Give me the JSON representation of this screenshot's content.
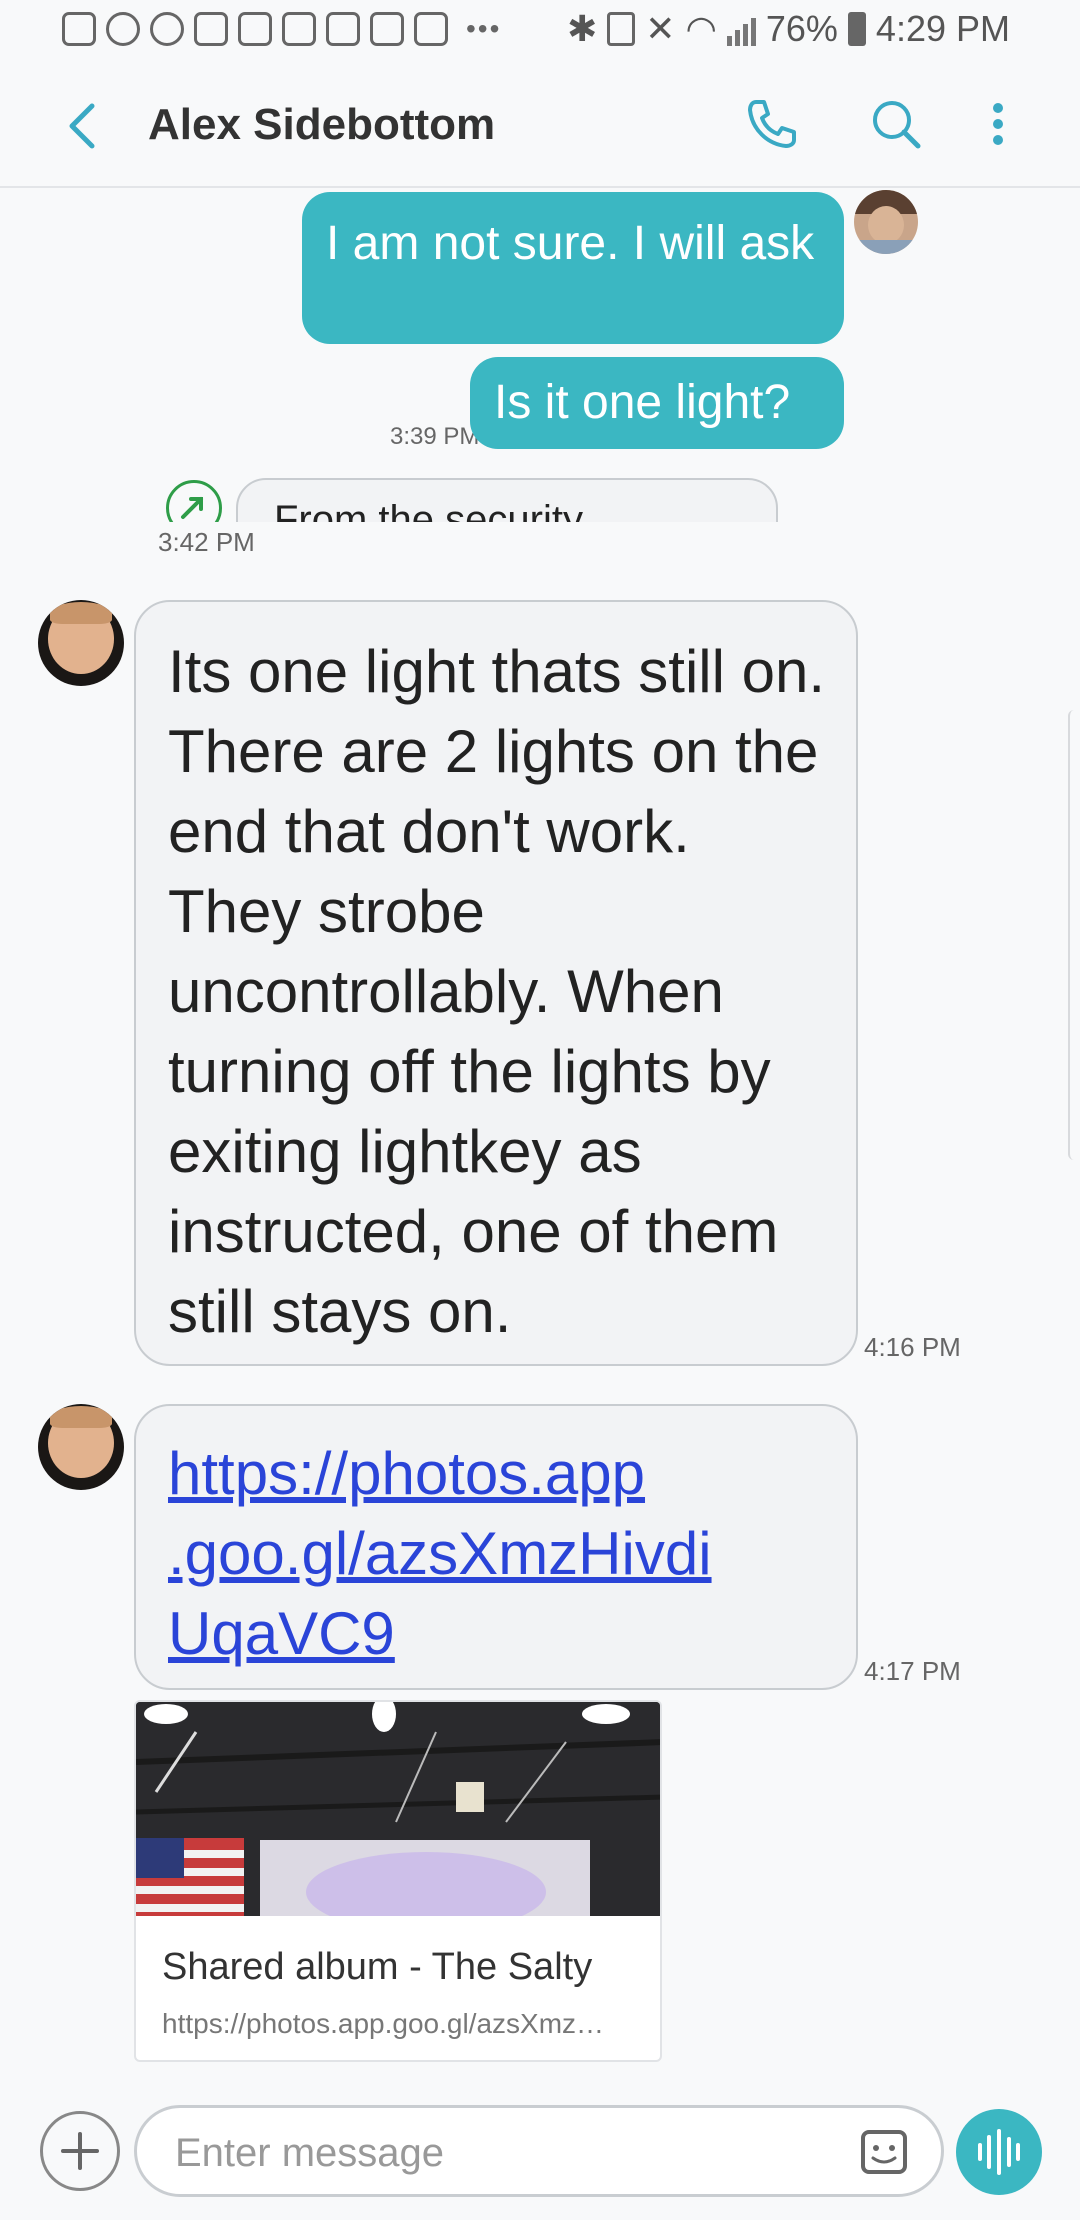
{
  "status_bar": {
    "battery": "76%",
    "time": "4:29 PM",
    "left_icons": [
      "app-s-icon",
      "app-rings-icon",
      "app-rings-icon",
      "mail-icon",
      "app-icon",
      "missed-call-icon",
      "mail-icon",
      "mail-icon",
      "shield-icon"
    ],
    "more": "•••"
  },
  "header": {
    "title": "Alex Sidebottom",
    "icons": [
      "back-icon",
      "phone-icon",
      "search-icon",
      "more-vertical-icon"
    ]
  },
  "messages": {
    "out_1": {
      "text": "I am not sure. I will ask"
    },
    "out_2": {
      "text": "Is it one light?",
      "time": "3:39 PM"
    },
    "partial": {
      "text": "From the security",
      "time": "3:42 PM"
    },
    "in_1": {
      "text": "Its one light thats still on. There are 2 lights on the end that don't work. They strobe uncontrollably. When turning off the lights by exiting lightkey as instructed, one of them still stays on.",
      "time": "4:16 PM"
    },
    "in_2": {
      "link": "https://photos.app.goo.gl/azsXmzHivdiUqaVC9",
      "link_lines": [
        "https://photos.app",
        ".goo.gl/azsXmzHivdi",
        "UqaVC9"
      ],
      "time": "4:17 PM"
    },
    "preview": {
      "title": "Shared album - The Salty",
      "url": "https://photos.app.goo.gl/azsXmz…"
    }
  },
  "composer": {
    "placeholder": "Enter message",
    "icons": [
      "plus-icon",
      "sticker-icon",
      "voice-icon"
    ]
  },
  "colors": {
    "accent": "#3bb7c2",
    "link": "#2a44d8",
    "incoming_bg": "#f2f3f5",
    "background": "#f8f9fa"
  }
}
